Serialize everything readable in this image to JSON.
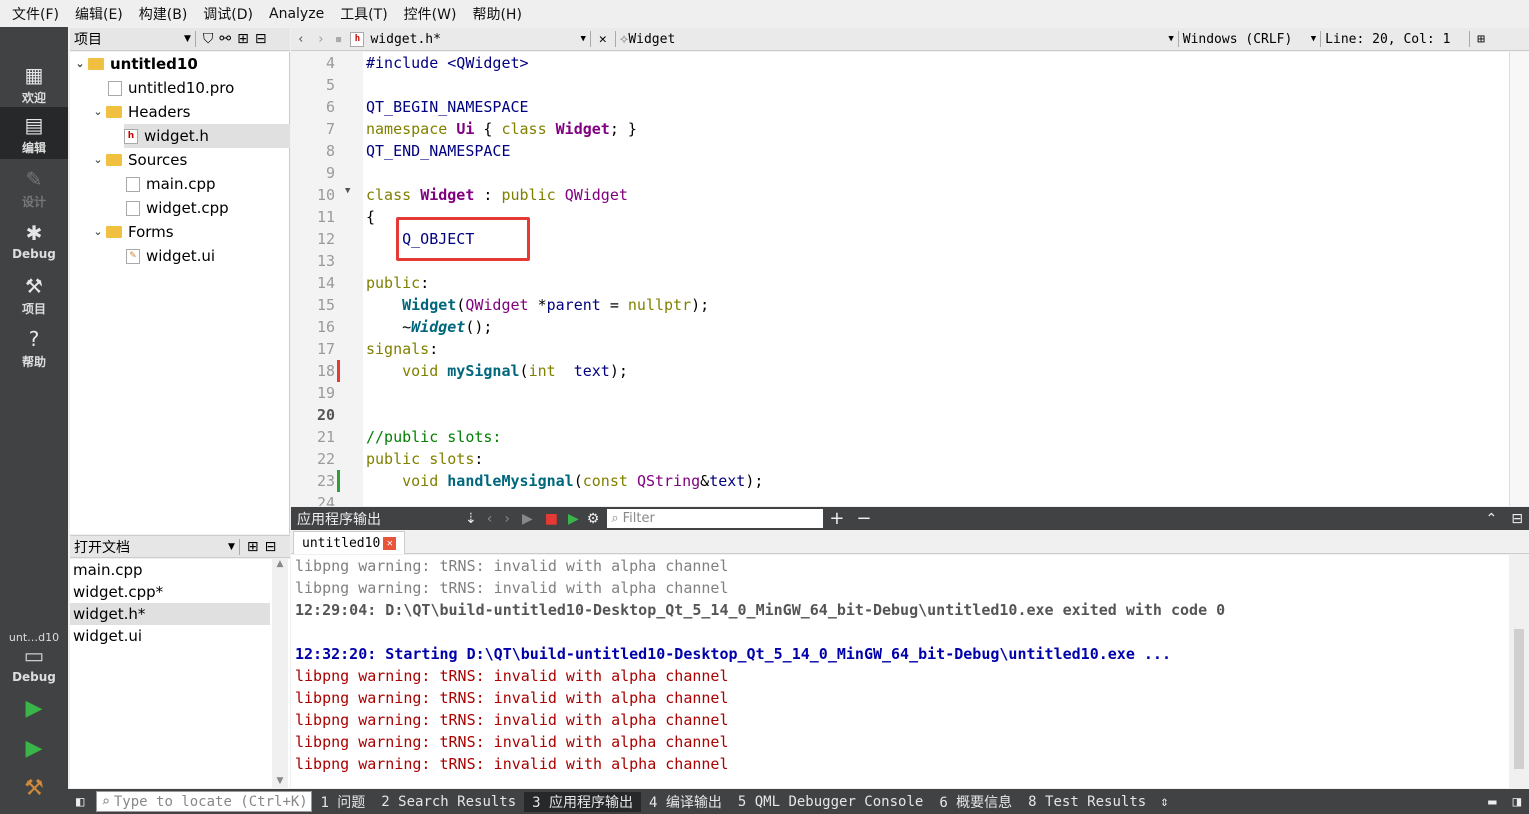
{
  "menu": [
    "文件(F)",
    "编辑(E)",
    "构建(B)",
    "调试(D)",
    "Analyze",
    "工具(T)",
    "控件(W)",
    "帮助(H)"
  ],
  "modes": [
    {
      "name": "welcome",
      "label": "欢迎",
      "icon": "grid-icon"
    },
    {
      "name": "edit",
      "label": "编辑",
      "icon": "edit-icon"
    },
    {
      "name": "design",
      "label": "设计",
      "icon": "pencil-icon"
    },
    {
      "name": "debug",
      "label": "Debug",
      "icon": "bug-icon"
    },
    {
      "name": "projects",
      "label": "项目",
      "icon": "wrench-icon"
    },
    {
      "name": "help",
      "label": "帮助",
      "icon": "help-icon"
    }
  ],
  "kit": {
    "project": "unt…d10",
    "config": "Debug"
  },
  "project_panel": {
    "title": "项目",
    "tree": [
      {
        "label": "untitled10",
        "bold": true
      },
      {
        "label": "untitled10.pro"
      },
      {
        "label": "Headers"
      },
      {
        "label": "widget.h"
      },
      {
        "label": "Sources"
      },
      {
        "label": "main.cpp"
      },
      {
        "label": "widget.cpp"
      },
      {
        "label": "Forms"
      },
      {
        "label": "widget.ui"
      }
    ]
  },
  "open_docs": {
    "title": "打开文档",
    "items": [
      "main.cpp",
      "widget.cpp*",
      "widget.h*",
      "widget.ui"
    ]
  },
  "editor": {
    "file": "widget.h*",
    "symbol": "Widget",
    "encoding": "Windows (CRLF)",
    "position": "Line: 20, Col: 1",
    "line_numbers": [
      "4",
      "5",
      "6",
      "7",
      "8",
      "9",
      "10",
      "11",
      "12",
      "13",
      "14",
      "15",
      "16",
      "17",
      "18",
      "19",
      "20",
      "21",
      "22",
      "23",
      "24"
    ]
  },
  "output": {
    "title": "应用程序输出",
    "filter_placeholder": "Filter",
    "tab": "untitled10",
    "lines": [
      "libpng warning: tRNS: invalid with alpha channel",
      "libpng warning: tRNS: invalid with alpha channel",
      "12:29:04: D:\\QT\\build-untitled10-Desktop_Qt_5_14_0_MinGW_64_bit-Debug\\untitled10.exe exited with code 0",
      "",
      "12:32:20: Starting D:\\QT\\build-untitled10-Desktop_Qt_5_14_0_MinGW_64_bit-Debug\\untitled10.exe ...",
      "libpng warning: tRNS: invalid with alpha channel",
      "libpng warning: tRNS: invalid with alpha channel",
      "libpng warning: tRNS: invalid with alpha channel",
      "libpng warning: tRNS: invalid with alpha channel",
      "libpng warning: tRNS: invalid with alpha channel"
    ]
  },
  "status": {
    "locator_placeholder": "Type to locate (Ctrl+K)",
    "panes": [
      "1 问题",
      "2 Search Results",
      "3 应用程序输出",
      "4 编译输出",
      "5 QML Debugger Console",
      "6 概要信息",
      "8 Test Results"
    ]
  },
  "colors": {
    "highlight_box": "#e53935",
    "modebar": "#404244"
  }
}
